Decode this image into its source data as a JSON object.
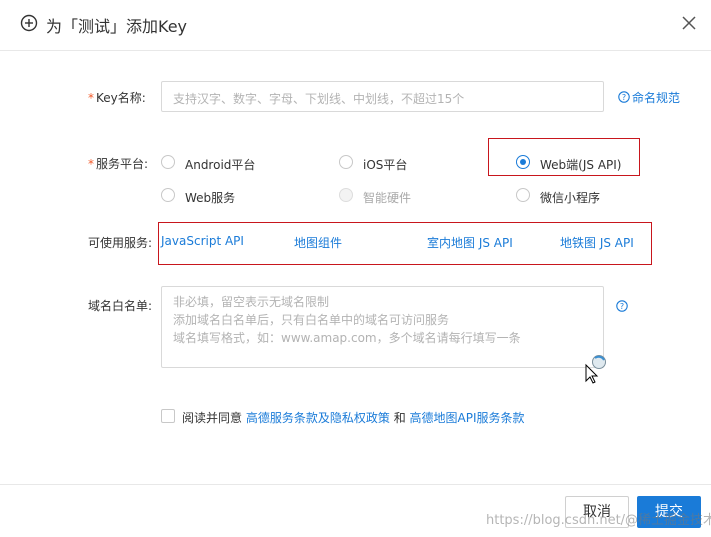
{
  "dialog": {
    "title": "为「测试」添加Key"
  },
  "form": {
    "key_name": {
      "required_mark": "*",
      "label": "Key名称:",
      "placeholder": "支持汉字、数字、字母、下划线、中划线，不超过15个",
      "help_link": "命名规范"
    },
    "platform": {
      "required_mark": "*",
      "label": "服务平台:",
      "options": [
        {
          "label": "Android平台",
          "checked": false,
          "disabled": false
        },
        {
          "label": "iOS平台",
          "checked": false,
          "disabled": false
        },
        {
          "label": "Web端(JS API)",
          "checked": true,
          "disabled": false
        },
        {
          "label": "Web服务",
          "checked": false,
          "disabled": false
        },
        {
          "label": "智能硬件",
          "checked": false,
          "disabled": true
        },
        {
          "label": "微信小程序",
          "checked": false,
          "disabled": false
        }
      ]
    },
    "services": {
      "label": "可使用服务:",
      "items": [
        "JavaScript API",
        "地图组件",
        "室内地图 JS API",
        "地铁图 JS API"
      ]
    },
    "domain_whitelist": {
      "label": "域名白名单:",
      "placeholder_lines": [
        "非必填，留空表示无域名限制",
        "添加域名白名单后，只有白名单中的域名可访问服务",
        "域名填写格式，如：www.amap.com，多个域名请每行填写一条"
      ]
    },
    "agreement": {
      "prefix": "阅读并同意",
      "link1": "高德服务条款及隐私权政策",
      "conjunction": "和",
      "link2": "高德地图API服务条款",
      "checked": false
    }
  },
  "footer": {
    "cancel_label": "取消",
    "submit_label": "提交"
  },
  "watermark": "https://blog.csdn.net/@稀土掘金技术社区",
  "colors": {
    "link": "#1a7bd8",
    "required": "#f25a2a",
    "highlight_box": "#c8161d",
    "primary_button": "#1a7bd8"
  }
}
